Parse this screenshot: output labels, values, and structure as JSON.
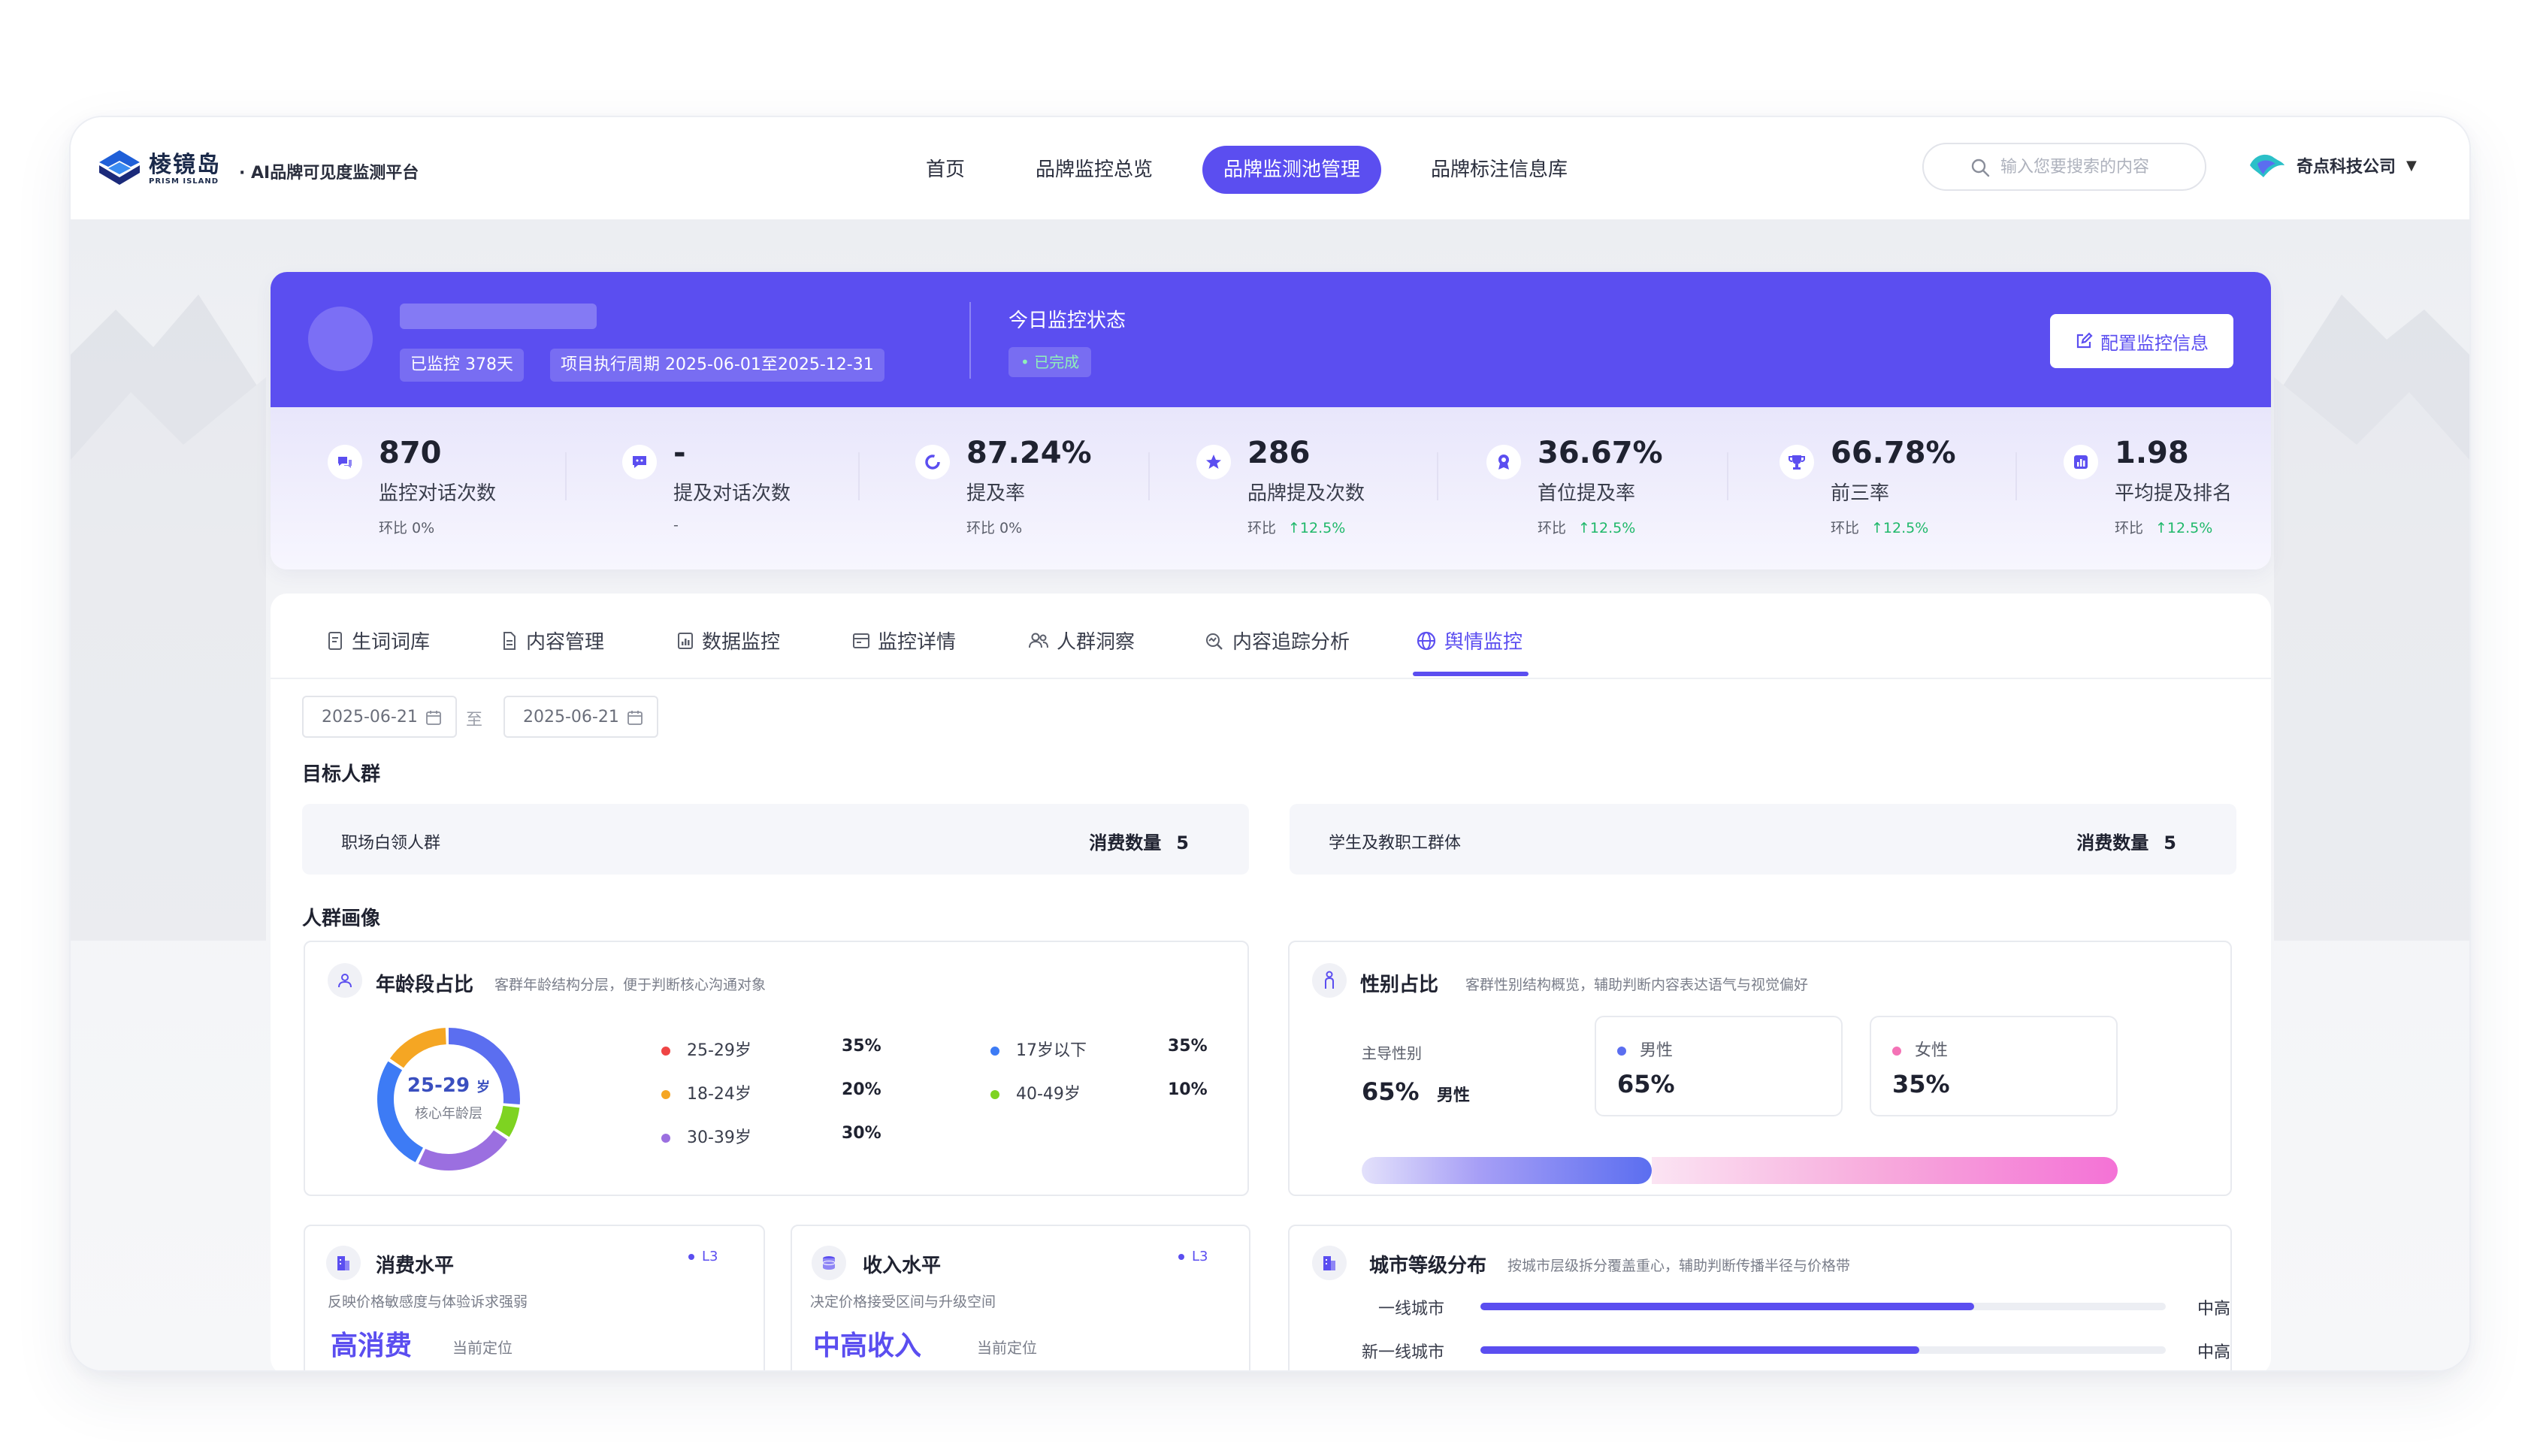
{
  "header": {
    "logo_cn": "棱镜岛",
    "logo_en": "PRISM ISLAND",
    "platform": "· AI品牌可见度监测平台",
    "nav": [
      {
        "label": "首页",
        "active": false
      },
      {
        "label": "品牌监控总览",
        "active": false
      },
      {
        "label": "品牌监测池管理",
        "active": true
      },
      {
        "label": "品牌标注信息库",
        "active": false
      }
    ],
    "search_placeholder": "输入您要搜索的内容",
    "company": "奇点科技公司"
  },
  "banner": {
    "monitored_days": "已监控  378天",
    "period": "项目执行周期  2025-06-01至2025-12-31",
    "status_title": "今日监控状态",
    "status_badge": "• 已完成",
    "config_button": "配置监控信息"
  },
  "stats": [
    {
      "icon": "chat-bubble-icon",
      "value": "870",
      "label": "监控对话次数",
      "compare": "环比  0%",
      "change": ""
    },
    {
      "icon": "message-icon",
      "value": "-",
      "label": "提及对话次数",
      "compare": "-",
      "change": ""
    },
    {
      "icon": "ring-icon",
      "value": "87.24%",
      "label": "提及率",
      "compare": "环比  0%",
      "change": ""
    },
    {
      "icon": "star-icon",
      "value": "286",
      "label": "品牌提及次数",
      "compare": "环比",
      "change": "↑12.5%"
    },
    {
      "icon": "award-icon",
      "value": "36.67%",
      "label": "首位提及率",
      "compare": "环比",
      "change": "↑12.5%"
    },
    {
      "icon": "trophy-icon",
      "value": "66.78%",
      "label": "前三率",
      "compare": "环比",
      "change": "↑12.5%"
    },
    {
      "icon": "bar-chart-icon",
      "value": "1.98",
      "label": "平均提及排名",
      "compare": "环比",
      "change": "↑12.5%"
    }
  ],
  "tabs": [
    {
      "label": "生词词库",
      "icon": "document-icon",
      "active": false
    },
    {
      "label": "内容管理",
      "icon": "file-icon",
      "active": false
    },
    {
      "label": "数据监控",
      "icon": "monitor-icon",
      "active": false
    },
    {
      "label": "监控详情",
      "icon": "detail-icon",
      "active": false
    },
    {
      "label": "人群洞察",
      "icon": "people-icon",
      "active": false
    },
    {
      "label": "内容追踪分析",
      "icon": "search-track-icon",
      "active": false
    },
    {
      "label": "舆情监控",
      "icon": "globe-icon",
      "active": true
    }
  ],
  "filters": {
    "date_start": "2025-06-21",
    "date_sep": "至",
    "date_end": "2025-06-21"
  },
  "target_groups": {
    "title": "目标人群",
    "items": [
      {
        "name": "职场白领人群",
        "count_label": "消费数量",
        "count": "5"
      },
      {
        "name": "学生及教职工群体",
        "count_label": "消费数量",
        "count": "5"
      }
    ]
  },
  "portrait": {
    "title": "人群画像",
    "age": {
      "title": "年龄段占比",
      "subtitle": "客群年龄结构分层，便于判断核心沟通对象",
      "center_value": "25-29",
      "center_unit": "岁",
      "center_label": "核心年龄层",
      "segments": [
        {
          "label": "25-29岁",
          "pct": "35%",
          "value": 35,
          "color": "#5b6ef0"
        },
        {
          "label": "18-24岁",
          "pct": "20%",
          "value": 20,
          "color": "#f5a623"
        },
        {
          "label": "30-39岁",
          "pct": "30%",
          "value": 30,
          "color": "#9b6fe0"
        },
        {
          "label": "17岁以下",
          "pct": "35%",
          "value": 35,
          "color": "#3d7bf5"
        },
        {
          "label": "40-49岁",
          "pct": "10%",
          "value": 10,
          "color": "#7ed321"
        }
      ],
      "dot_colors": [
        "#ef4444",
        "#f5a623",
        "#9b6fe0",
        "#3d7bf5",
        "#7ed321"
      ]
    },
    "gender": {
      "title": "性别占比",
      "subtitle": "客群性别结构概览，辅助判断内容表达语气与视觉偏好",
      "dominant_label": "主导性别",
      "dominant_pct": "65%",
      "dominant_gender": "男性",
      "male_label": "男性",
      "male_pct": "65%",
      "male_value": 65,
      "female_label": "女性",
      "female_pct": "35%",
      "female_value": 35
    },
    "consumption": {
      "title": "消费水平",
      "level": "L3",
      "subtitle": "反映价格敏感度与体验诉求强弱",
      "value": "高消费",
      "position_label": "当前定位"
    },
    "income": {
      "title": "收入水平",
      "level": "L3",
      "subtitle": "决定价格接受区间与升级空间",
      "value": "中高收入",
      "position_label": "当前定位"
    },
    "city": {
      "title": "城市等级分布",
      "subtitle": "按城市层级拆分覆盖重心，辅助判断传播半径与价格带",
      "rows": [
        {
          "name": "一线城市",
          "value": 0.72,
          "level": "中高"
        },
        {
          "name": "新一线城市",
          "value": 0.64,
          "level": "中高"
        }
      ]
    }
  }
}
